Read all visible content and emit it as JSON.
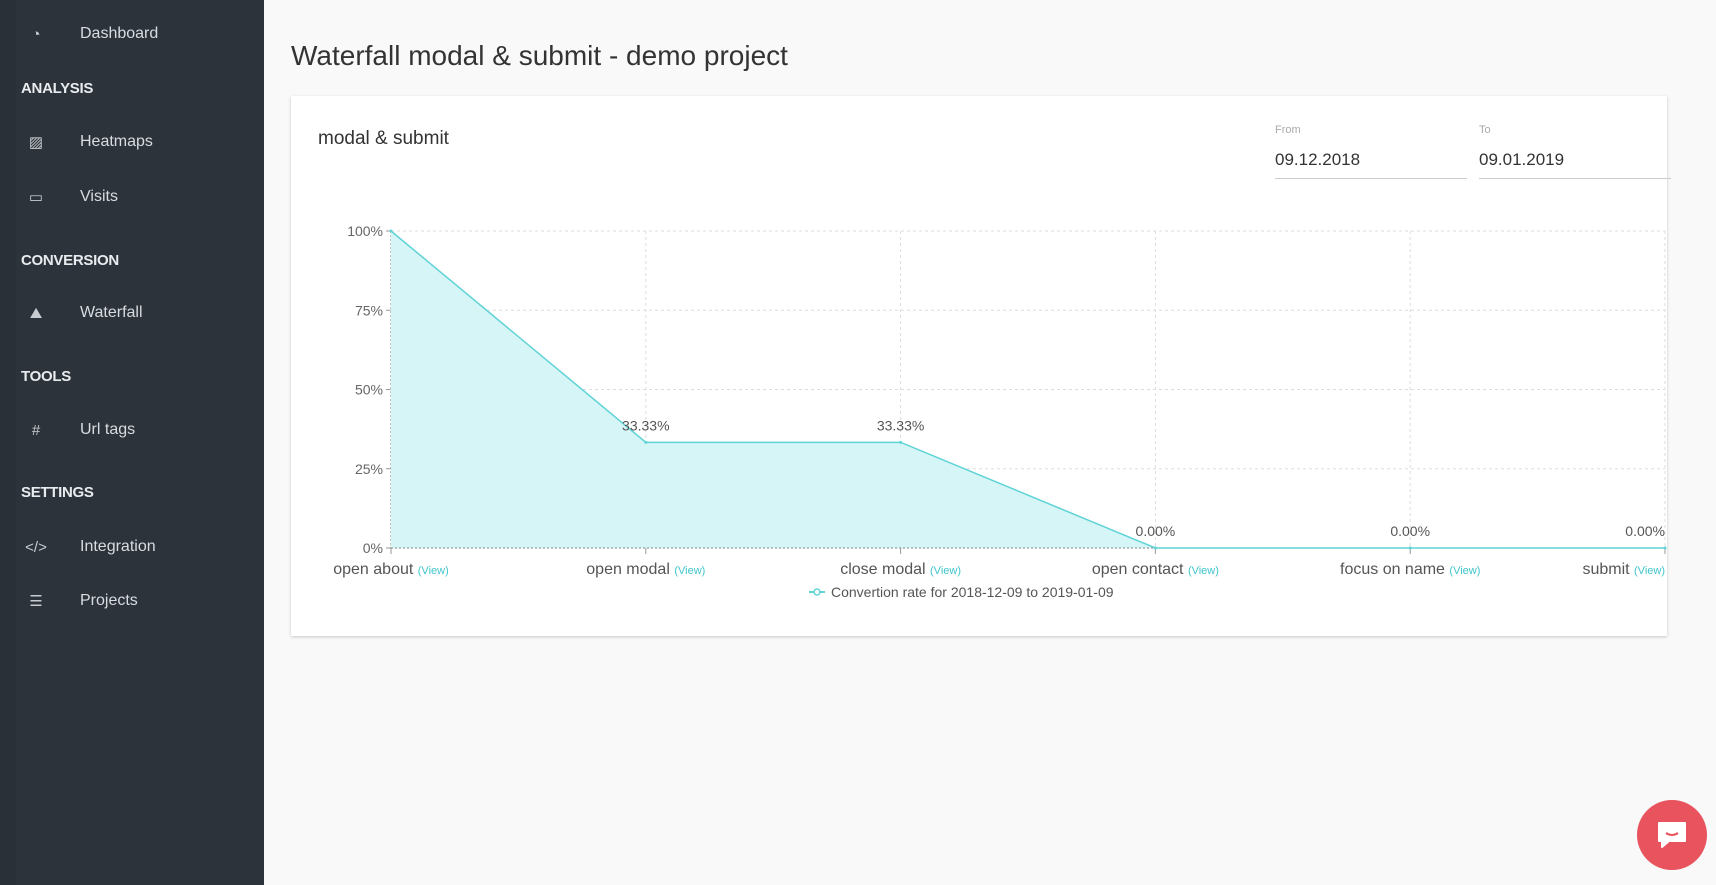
{
  "sidebar": {
    "dashboard": "Dashboard",
    "sections": [
      {
        "title": "ANALYSIS",
        "items": [
          "Heatmaps",
          "Visits"
        ]
      },
      {
        "title": "CONVERSION",
        "items": [
          "Waterfall"
        ]
      },
      {
        "title": "TOOLS",
        "items": [
          "Url tags"
        ]
      },
      {
        "title": "SETTINGS",
        "items": [
          "Integration",
          "Projects"
        ]
      }
    ]
  },
  "page": {
    "title": "Waterfall modal & submit - demo project"
  },
  "card": {
    "title": "modal & submit",
    "from": {
      "label": "From",
      "value": "09.12.2018"
    },
    "to": {
      "label": "To",
      "value": "09.01.2019"
    }
  },
  "chart_data": {
    "type": "area",
    "categories": [
      "open about",
      "open modal",
      "close modal",
      "open contact",
      "focus on name",
      "submit"
    ],
    "view_link": "(View)",
    "series": [
      {
        "name": "Convertion rate for 2018-12-09 to 2019-01-09",
        "values": [
          100,
          33.33,
          33.33,
          0,
          0,
          0
        ]
      }
    ],
    "data_labels": [
      "",
      "33.33%",
      "33.33%",
      "0.00%",
      "0.00%",
      "0.00%"
    ],
    "yticks": [
      "0%",
      "25%",
      "50%",
      "75%",
      "100%"
    ],
    "ylim": [
      0,
      100
    ],
    "grid": true,
    "legend": "bottom",
    "color": "#5fd3d6",
    "fill": "#d6f5f6"
  },
  "chat": {
    "icon": "chat-bubble-icon",
    "color": "#e8535d"
  }
}
